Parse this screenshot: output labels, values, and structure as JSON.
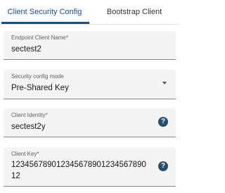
{
  "tabs": [
    {
      "label": "Client Security Config",
      "active": true
    },
    {
      "label": "Bootstrap Client",
      "active": false
    }
  ],
  "fields": {
    "endpoint_client_name": {
      "label": "Endpoint Client Name*",
      "value": "sectest2"
    },
    "security_config_mode": {
      "label": "Security config mode",
      "value": "Pre-Shared Key",
      "icon": "chevron-down-icon"
    },
    "client_identity": {
      "label": "Client Identity*",
      "value": "sectest2y",
      "icon": "help-icon"
    },
    "client_key": {
      "label": "Client Key*",
      "value": "123456789012345678901234567890 12",
      "icon": "help-icon"
    }
  },
  "help_glyph": "?",
  "colors": {
    "accent": "#1e4a86",
    "field_background": "#f4f4f4",
    "help_icon": "#264e6a"
  }
}
